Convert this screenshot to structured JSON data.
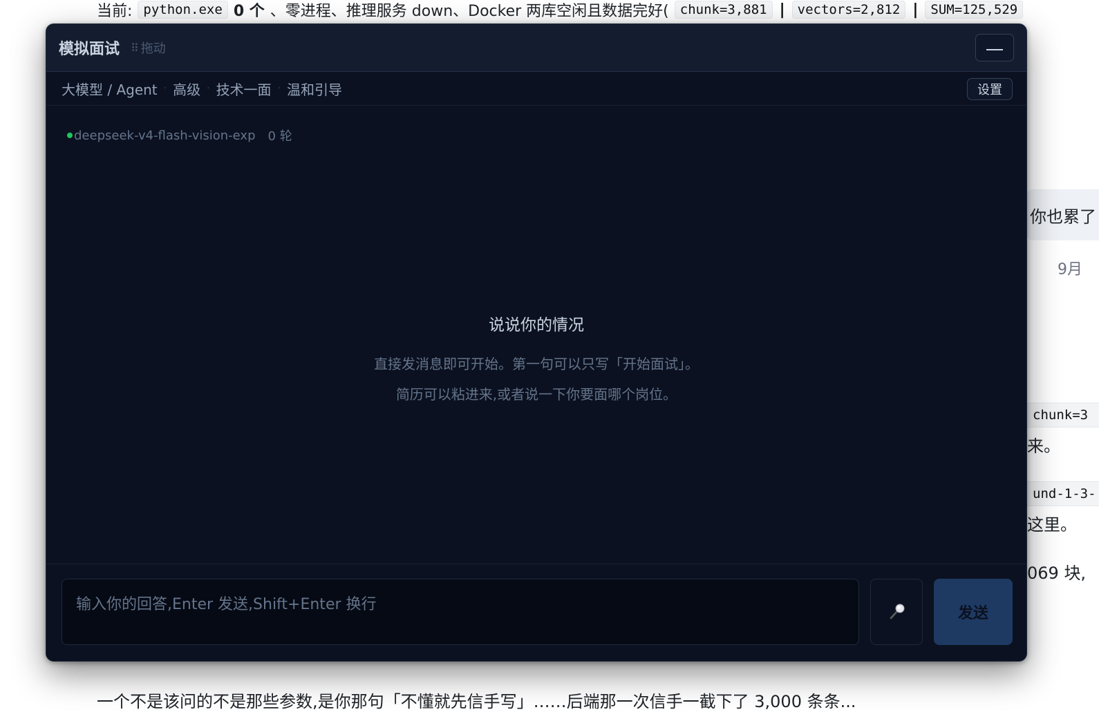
{
  "background": {
    "top_line": {
      "prefix": "当前:",
      "code_python": "python.exe",
      "bold_count": "0 个",
      "text_mid": "、零进程、推理服务 down、Docker 两库空闲且数据完好(",
      "code_chunk": "chunk=3,881",
      "sep1": "|",
      "code_vectors": "vectors=2,812",
      "sep2": "|",
      "code_sum": "SUM=125,529"
    },
    "right_bubble_text": "你也累了",
    "right_date": "9月",
    "right_code_1": "chunk=3",
    "right_text_1": "来。",
    "right_code_2": "und-1-3-",
    "right_text_2": "这里。",
    "right_text_3": "069 块,",
    "bottom_line": "一个不是该问的不是那些参数,是你那句「不懂就先信手写」……后端那一次信手一截下了 3,000 条条..."
  },
  "modal": {
    "title": "模拟面试",
    "drag_label": "拖动",
    "minimize_label": "—",
    "config": {
      "crumbs": [
        "大模型 / Agent",
        "高级",
        "技术一面",
        "温和引导"
      ],
      "settings_label": "设置"
    },
    "model_name": "deepseek-v4-flash-vision-exp",
    "rounds": "0 轮",
    "empty_state": {
      "title": "说说你的情况",
      "line1": "直接发消息即可开始。第一句可以只写「开始面试」。",
      "line2": "简历可以粘进来,或者说一下你要面哪个岗位。"
    },
    "composer": {
      "placeholder": "输入你的回答,Enter 发送,Shift+Enter 换行",
      "send_label": "发送",
      "mic_icon": "microphone-icon"
    }
  },
  "colors": {
    "modal_bg": "#0b1120",
    "titlebar_bg": "#141d2f",
    "status_green": "#22c55e",
    "send_bg": "#1e3a63"
  }
}
